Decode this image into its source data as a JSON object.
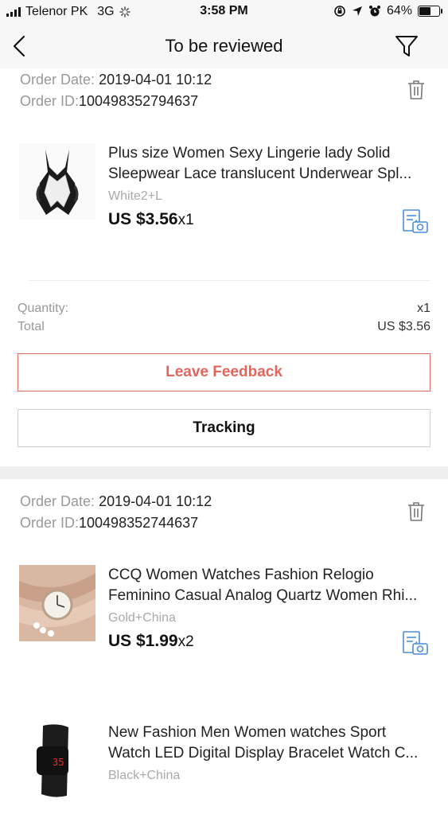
{
  "status_bar": {
    "carrier": "Telenor PK",
    "network": "3G",
    "time": "3:58 PM",
    "battery": "64%",
    "battery_level": 0.64
  },
  "nav": {
    "title": "To be reviewed",
    "back_icon": "chevron-left-icon",
    "filter_icon": "filter-icon"
  },
  "colors": {
    "accent": "#e2665d",
    "icon_blue": "#4a8fd8",
    "muted": "#999999",
    "section_gap": "#efefef"
  },
  "orders": [
    {
      "date_label": "Order Date:",
      "date": "2019-04-01 10:12",
      "id_label": "Order ID:",
      "id": "100498352794637",
      "products": [
        {
          "title_line1": "Plus size Women Sexy Lingerie lady Solid",
          "title_line2": "Sleepwear Lace translucent  Underwear Spl...",
          "variant": "White2+L",
          "price": "US $3.56",
          "qty": "x1"
        }
      ],
      "quantity_label": "Quantity:",
      "quantity_value": "x1",
      "total_label": "Total",
      "total_value": "US $3.56",
      "feedback_label": "Leave Feedback",
      "tracking_label": "Tracking"
    },
    {
      "date_label": "Order Date:",
      "date": "2019-04-01 10:12",
      "id_label": "Order ID:",
      "id": "100498352744637",
      "products": [
        {
          "title_line1": "CCQ Women Watches Fashion Relogio",
          "title_line2": "Feminino Casual Analog Quartz Women Rhi...",
          "variant": "Gold+China",
          "price": "US $1.99",
          "qty": "x2"
        },
        {
          "title_line1": "New Fashion Men Women watches Sport",
          "title_line2": "Watch LED Digital Display Bracelet Watch C...",
          "variant": "Black+China",
          "price": "",
          "qty": ""
        }
      ]
    }
  ]
}
